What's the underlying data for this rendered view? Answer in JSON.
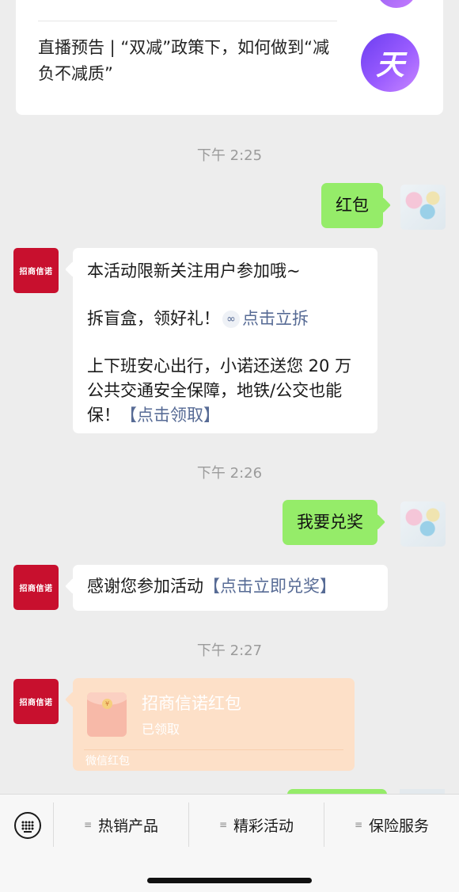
{
  "article_card": {
    "title": "直播预告 | “双减”政策下，如何做到“减负不减质”",
    "logo_text": "天"
  },
  "timestamps": [
    "下午 2:25",
    "下午 2:26",
    "下午 2:27"
  ],
  "avatar_brand": "招商信诺",
  "messages": {
    "m1_text": "红包",
    "m2": {
      "line1": "本活动限新关注用户参加哦~",
      "line2_prefix": "拆盲盒，领好礼！",
      "line2_link": "点击立拆",
      "line3": "上下班安心出行，小诺还送您 20 万公共交通安全保障，地铁/公交也能保！",
      "line3_link": "【点击领取】"
    },
    "m3_text": "我要兑奖",
    "m4": {
      "prefix": "感谢您参加活动",
      "link": "【点击立即兑奖】"
    },
    "red_packet": {
      "title": "招商信诺红包",
      "status": "已领取",
      "footer": "微信红包"
    }
  },
  "menu": {
    "items": [
      "热销产品",
      "精彩活动",
      "保险服务"
    ]
  },
  "colors": {
    "chat_bg": "#ededed",
    "green_bubble": "#95ec69",
    "link": "#576b95",
    "brand_red": "#c8102e",
    "red_packet": "#fde0c8"
  }
}
